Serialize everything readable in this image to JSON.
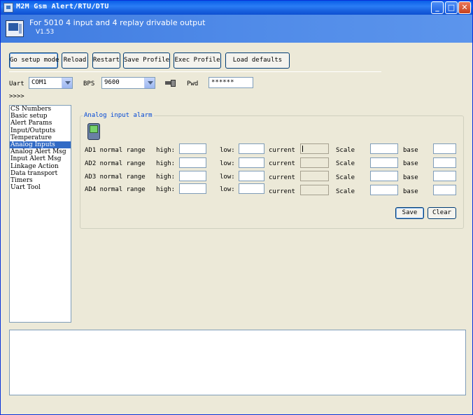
{
  "window": {
    "title": "M2M Gsm Alert/RTU/DTU"
  },
  "header": {
    "product": "For 5010 4 input and 4 replay drivable output",
    "version": "V1.53"
  },
  "toolbar": {
    "go_setup": "Go setup mode",
    "reload": "Reload",
    "restart": "Restart",
    "save_profile": "Save Profile",
    "exec_profile": "Exec Profile",
    "load_defaults": "Load defaults"
  },
  "connection": {
    "uart_label": "Uart",
    "uart_value": "COM1",
    "bps_label": "BPS",
    "bps_value": "9600",
    "pwd_label": "Pwd",
    "pwd_value": "******",
    "more": ">>>>"
  },
  "nav": {
    "items": [
      "CS Numbers",
      "Basic setup",
      "Alert Params",
      "Input/Outputs",
      "Temperature",
      "Analog Inputs",
      "Analog Alert Msg",
      "Input Alert Msg",
      "Linkage Action",
      "Data transport",
      "Timers",
      "Uart Tool"
    ],
    "selected": "Analog Inputs"
  },
  "analog": {
    "group_title": "Analog input alarm",
    "high_label": "high:",
    "low_label": "low:",
    "current_label": "current",
    "scale_label": "Scale",
    "base_label": "base",
    "rows": [
      {
        "name": "AD1 normal range"
      },
      {
        "name": "AD2 normal range"
      },
      {
        "name": "AD3 normal range"
      },
      {
        "name": "AD4 normal range"
      }
    ],
    "save": "Save",
    "clear": "Clear"
  }
}
